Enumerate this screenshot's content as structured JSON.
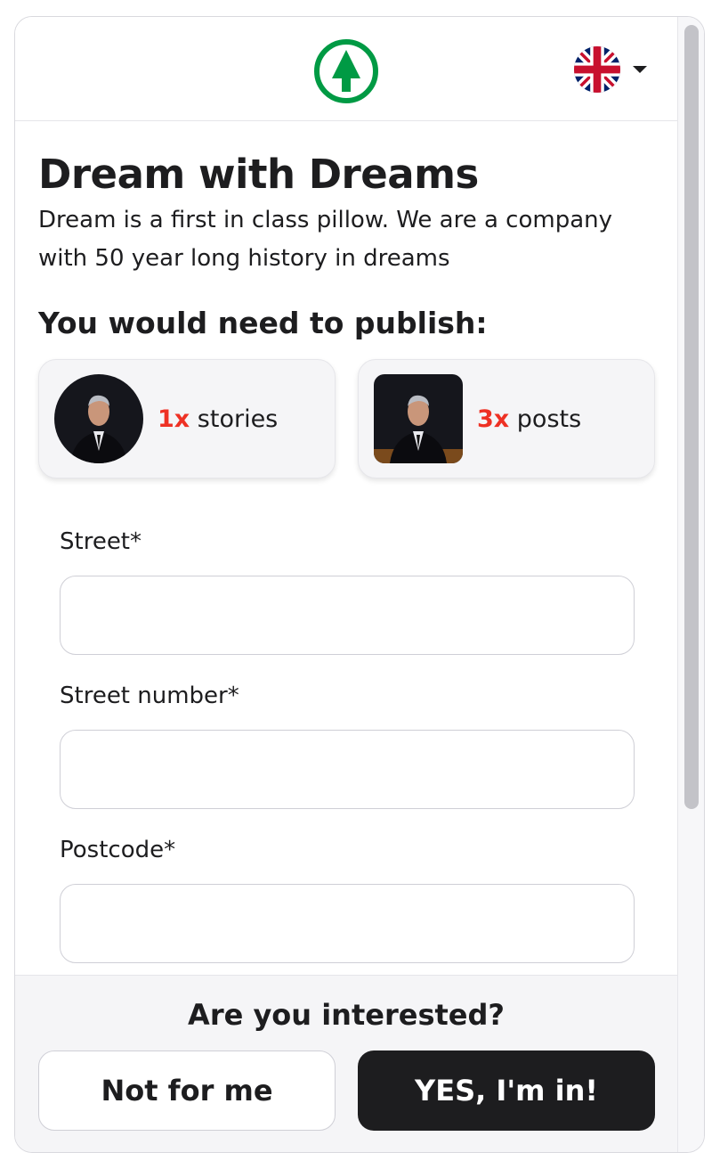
{
  "header": {
    "logo_icon": "spar-tree-logo-icon",
    "language_icon": "uk-flag-icon",
    "brand_color": "#009a44"
  },
  "campaign": {
    "title": "Dream with Dreams",
    "description": "Dream is a first in class pillow. We are a company with 50 year long history in dreams",
    "requirements_title": "You would need to publish:",
    "requirements": [
      {
        "count": "1x",
        "label": "stories"
      },
      {
        "count": "3x",
        "label": "posts"
      }
    ],
    "accent_color": "#ee3124"
  },
  "form": {
    "fields": [
      {
        "label": "Street*",
        "value": "",
        "placeholder": ""
      },
      {
        "label": "Street number*",
        "value": "",
        "placeholder": ""
      },
      {
        "label": "Postcode*",
        "value": "",
        "placeholder": ""
      }
    ]
  },
  "footer": {
    "question": "Are you interested?",
    "decline_label": "Not for me",
    "accept_label": "YES, I'm in!"
  }
}
